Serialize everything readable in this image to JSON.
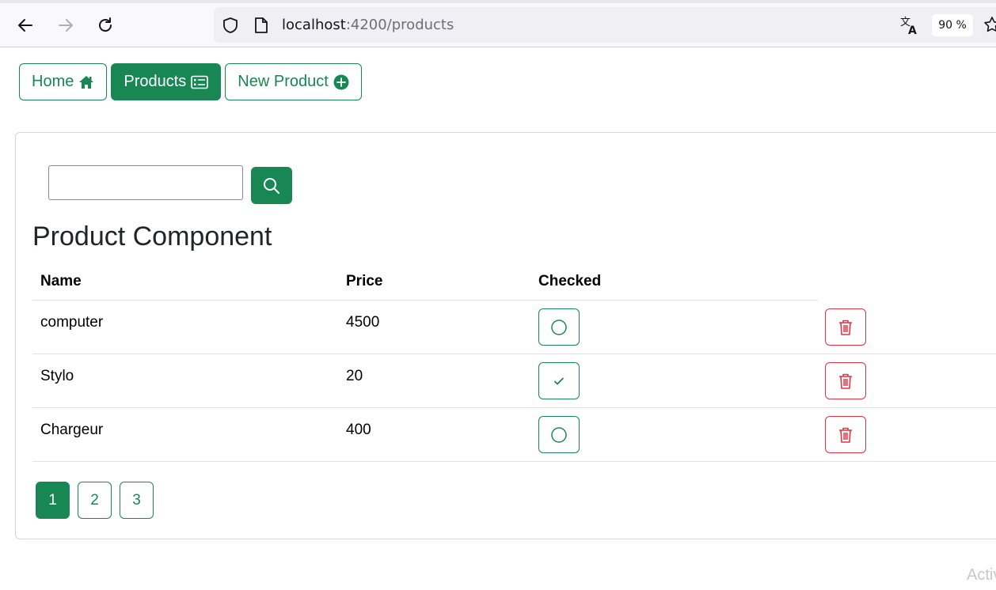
{
  "browser": {
    "url_host": "localhost",
    "url_path": ":4200/products",
    "zoom": "90 %"
  },
  "nav": {
    "home_label": "Home",
    "products_label": "Products",
    "new_product_label": "New Product"
  },
  "search": {
    "value": ""
  },
  "page_title": "Product Component",
  "table": {
    "headers": [
      "Name",
      "Price",
      "Checked"
    ],
    "rows": [
      {
        "name": "computer",
        "price": "4500",
        "checked": false
      },
      {
        "name": "Stylo",
        "price": "20",
        "checked": true
      },
      {
        "name": "Chargeur",
        "price": "400",
        "checked": false
      }
    ]
  },
  "pagination": {
    "pages": [
      "1",
      "2",
      "3"
    ],
    "current": "1"
  },
  "watermark_text": "Activ",
  "colors": {
    "primary": "#198754",
    "danger": "#dc3545"
  }
}
